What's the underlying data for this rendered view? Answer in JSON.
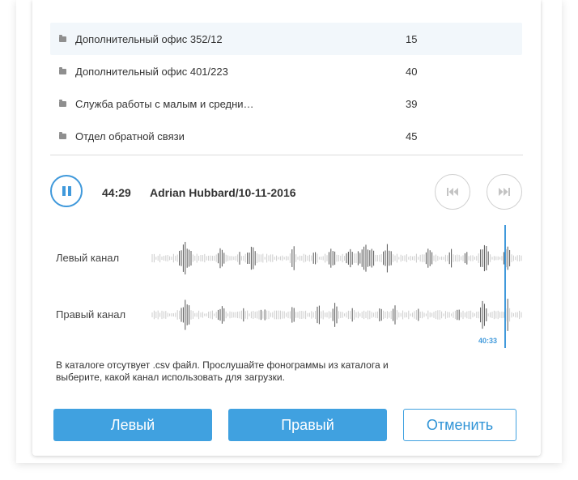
{
  "list": [
    {
      "name": "Дополнительный офис 352/12",
      "count": "15",
      "highlighted": true
    },
    {
      "name": "Дополнительный офис 401/223",
      "count": "40",
      "highlighted": false
    },
    {
      "name": "Служба работы с малым и средни…",
      "count": "39",
      "highlighted": false
    },
    {
      "name": "Отдел обратной связи",
      "count": "45",
      "highlighted": false
    }
  ],
  "player": {
    "time": "44:29",
    "track": "Adrian Hubbard/10-11-2016",
    "cursor_time": "40:33",
    "state": "playing"
  },
  "channels": {
    "left": "Левый канал",
    "right": "Правый канал"
  },
  "message": "В каталоге отсутвует .csv файл. Прослушайте фонограммы из каталога и выберите, какой канал использовать для загрузки.",
  "buttons": {
    "left": "Левый",
    "right": "Правый",
    "cancel": "Отменить"
  },
  "colors": {
    "accent": "#40a1e0",
    "wave_played": "#555555",
    "wave_unplayed": "#cccccc"
  },
  "icons": {
    "play": "pause-icon",
    "prev": "skip-back-icon",
    "next": "skip-forward-icon",
    "folder": "folder-icon"
  }
}
